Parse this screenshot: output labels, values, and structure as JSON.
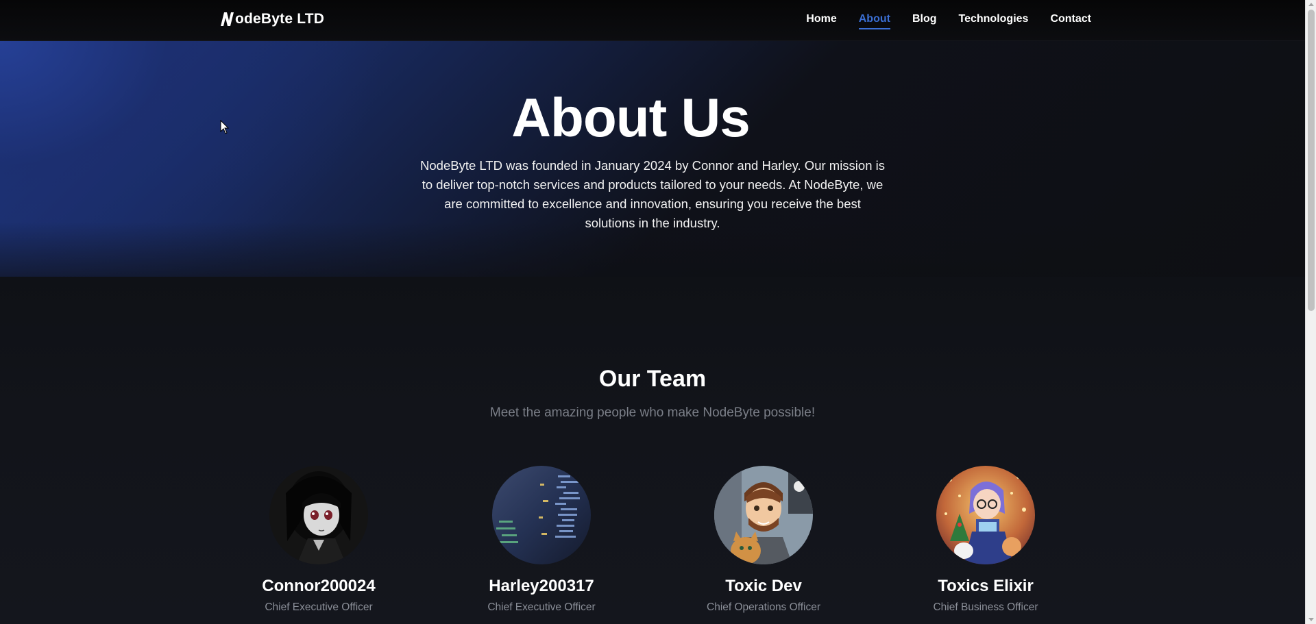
{
  "nav": {
    "brand_initial": "N",
    "brand_text": "odeByte LTD",
    "links": [
      "Home",
      "About",
      "Blog",
      "Technologies",
      "Contact"
    ],
    "active_link": "About"
  },
  "hero": {
    "title": "About Us",
    "text": "NodeByte LTD was founded in January 2024 by Connor and Harley. Our mission is to deliver top-notch services and products tailored to your needs. At NodeByte, we are committed to excellence and innovation, ensuring you receive the best solutions in the industry."
  },
  "team": {
    "title": "Our Team",
    "subtitle": "Meet the amazing people who make NodeByte possible!",
    "members": [
      {
        "name": "Connor200024",
        "role": "Chief Executive Officer",
        "avatar": "anime-girl-avatar"
      },
      {
        "name": "Harley200317",
        "role": "Chief Executive Officer",
        "avatar": "code-screen-avatar"
      },
      {
        "name": "Toxic Dev",
        "role": "Chief Operations Officer",
        "avatar": "cartoon-man-with-cat-avatar"
      },
      {
        "name": "Toxics Elixir",
        "role": "Chief Business Officer",
        "avatar": "cartoon-woman-festive-avatar"
      }
    ]
  },
  "colors": {
    "accent": "#3b6fd4",
    "hero_blue": "#1f3a8c",
    "background": "#0d0e12",
    "muted_text": "#8b8f98"
  }
}
